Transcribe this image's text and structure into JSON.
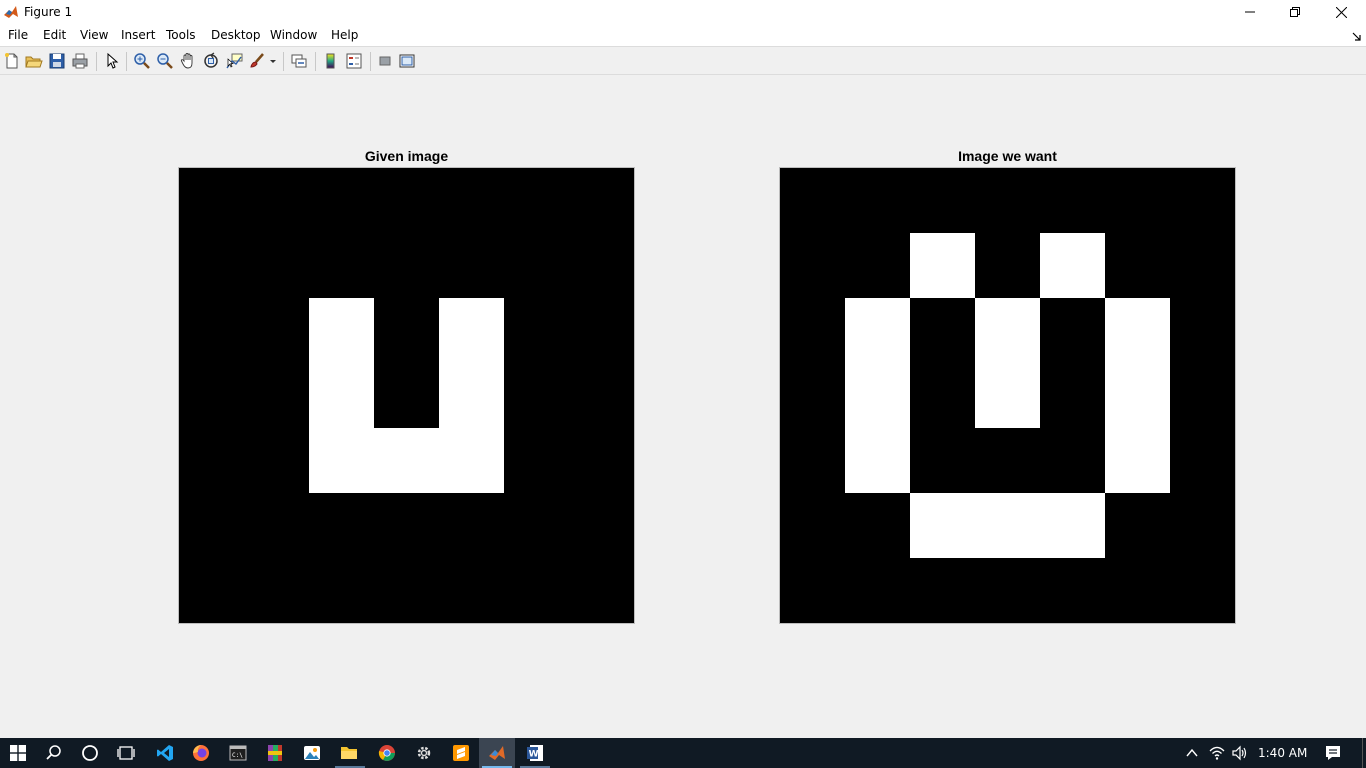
{
  "window": {
    "title": "Figure 1"
  },
  "menu": {
    "items": [
      "File",
      "Edit",
      "View",
      "Insert",
      "Tools",
      "Desktop",
      "Window",
      "Help"
    ]
  },
  "toolbar": {
    "buttons": [
      "new-figure",
      "open-file",
      "save-figure",
      "print-figure",
      "edit-plot",
      "zoom-in",
      "zoom-out",
      "pan",
      "rotate-3d",
      "data-cursor",
      "brush",
      "link-plot",
      "insert-colorbar",
      "insert-legend",
      "hide-plot-tools",
      "show-plot-tools"
    ]
  },
  "figure": {
    "left_axes": {
      "title": "Given image",
      "grid_size": 7,
      "white_cells": [
        [
          2,
          2
        ],
        [
          2,
          4
        ],
        [
          3,
          2
        ],
        [
          3,
          4
        ],
        [
          4,
          2
        ],
        [
          4,
          3
        ],
        [
          4,
          4
        ]
      ]
    },
    "right_axes": {
      "title": "Image we want",
      "grid_size": 7,
      "white_cells": [
        [
          1,
          2
        ],
        [
          1,
          4
        ],
        [
          2,
          1
        ],
        [
          2,
          3
        ],
        [
          2,
          5
        ],
        [
          3,
          1
        ],
        [
          3,
          3
        ],
        [
          3,
          5
        ],
        [
          4,
          1
        ],
        [
          4,
          5
        ],
        [
          5,
          2
        ],
        [
          5,
          3
        ],
        [
          5,
          4
        ]
      ]
    }
  },
  "taskbar": {
    "apps": [
      "start",
      "search",
      "cortana",
      "task-view",
      "vscode",
      "firefox",
      "terminal",
      "winrar",
      "photos",
      "file-explorer",
      "chrome",
      "settings",
      "sublime",
      "matlab",
      "word"
    ],
    "active_app": "matlab",
    "time": "1:40 AM"
  },
  "colors": {
    "figure_background": "#f0f0f0",
    "image_black": "#000000",
    "image_white": "#ffffff",
    "taskbar": "#101a24",
    "accent": "#76b9ed"
  }
}
